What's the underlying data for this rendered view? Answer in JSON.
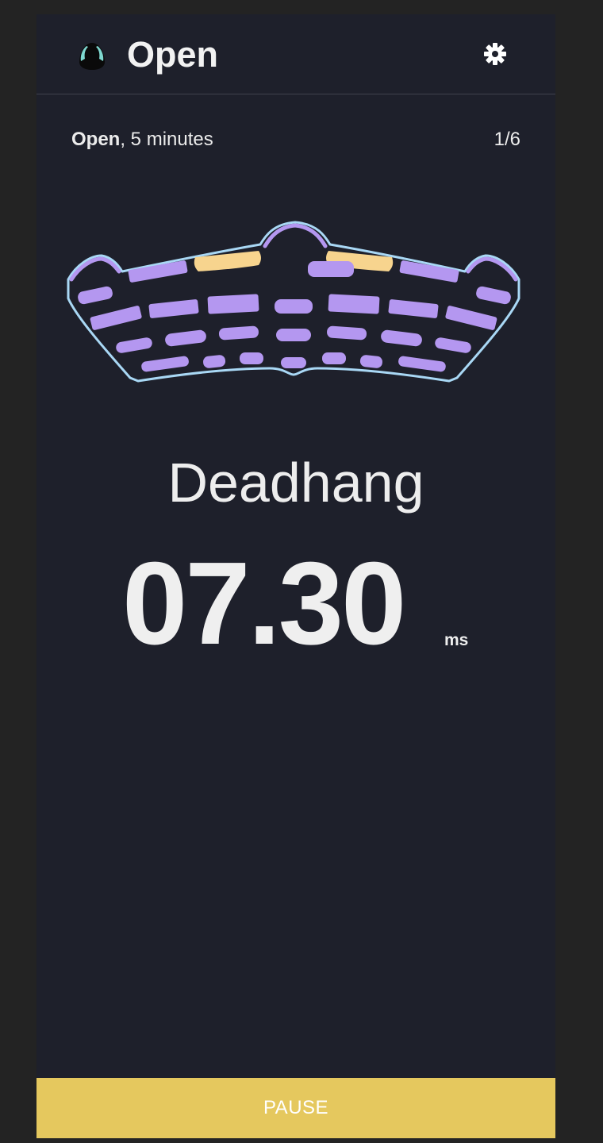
{
  "header": {
    "title": "Open",
    "settings_icon": "gear-icon",
    "logo_icon": "climbing-hold-logo"
  },
  "session": {
    "grip_name": "Open",
    "duration_text": ", 5 minutes",
    "progress": "1/6"
  },
  "board": {
    "hold_color": "#b497f0",
    "active_hold_color": "#f7d48e",
    "outline_color": "#a9d8f5",
    "active_holds": [
      "top-left-jug",
      "top-right-jug"
    ]
  },
  "exercise": {
    "name": "Deadhang",
    "timer_value": "07.30",
    "timer_unit": "ms"
  },
  "controls": {
    "pause_label": "PAUSE",
    "pause_color": "#e5c85e"
  }
}
